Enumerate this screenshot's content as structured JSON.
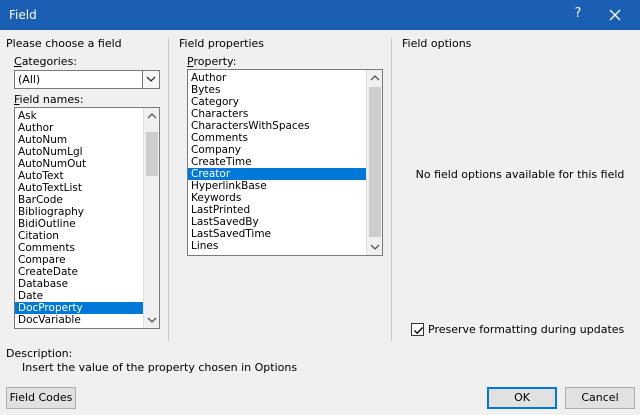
{
  "window": {
    "title": "Field",
    "help": "?",
    "close_icon": "close-icon"
  },
  "left_group": {
    "title": "Please choose a field",
    "categories_label": "Categories:",
    "categories_value": "(All)",
    "field_names_label": "Field names:",
    "field_names": [
      "Ask",
      "Author",
      "AutoNum",
      "AutoNumLgl",
      "AutoNumOut",
      "AutoText",
      "AutoTextList",
      "BarCode",
      "Bibliography",
      "BidiOutline",
      "Citation",
      "Comments",
      "Compare",
      "CreateDate",
      "Database",
      "Date",
      "DocProperty",
      "DocVariable"
    ],
    "selected_field": "DocProperty"
  },
  "middle_group": {
    "title": "Field properties",
    "property_label": "Property:",
    "properties": [
      "Author",
      "Bytes",
      "Category",
      "Characters",
      "CharactersWithSpaces",
      "Comments",
      "Company",
      "CreateTime",
      "Creator",
      "HyperlinkBase",
      "Keywords",
      "LastPrinted",
      "LastSavedBy",
      "LastSavedTime",
      "Lines"
    ],
    "selected_property": "Creator"
  },
  "right_group": {
    "title": "Field options",
    "no_options_text": "No field options available for this field",
    "preserve_label": "Preserve formatting during updates",
    "preserve_checked": true
  },
  "description": {
    "label": "Description:",
    "text": "Insert the value of the property chosen in Options"
  },
  "buttons": {
    "field_codes": "Field Codes",
    "ok": "OK",
    "cancel": "Cancel"
  },
  "colors": {
    "titlebar": "#1a5fb4",
    "selection": "#0078d7"
  }
}
